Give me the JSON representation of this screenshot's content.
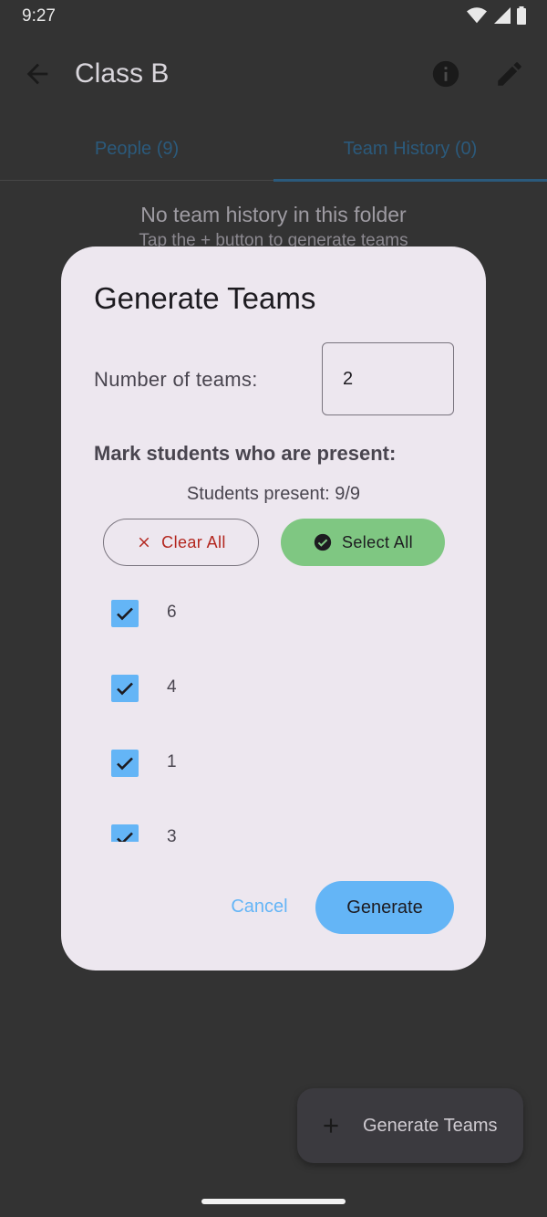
{
  "status_bar": {
    "time": "9:27"
  },
  "app_bar": {
    "title": "Class B"
  },
  "tabs": [
    {
      "label": "People (9)",
      "selected": false
    },
    {
      "label": "Team History (0)",
      "selected": true
    }
  ],
  "empty_state": {
    "title": "No team history in this folder",
    "subtitle": "Tap the + button to generate teams"
  },
  "fab": {
    "label": "Generate Teams"
  },
  "dialog": {
    "title": "Generate Teams",
    "number_label": "Number of teams:",
    "number_value": "2",
    "mark_label": "Mark students who are present:",
    "present_count": "Students present: 9/9",
    "clear_all_label": "Clear All",
    "select_all_label": "Select All",
    "students": [
      {
        "name": "6",
        "checked": true
      },
      {
        "name": "4",
        "checked": true
      },
      {
        "name": "1",
        "checked": true
      },
      {
        "name": "3",
        "checked": true
      }
    ],
    "cancel_label": "Cancel",
    "generate_label": "Generate"
  },
  "colors": {
    "accent": "#64b5f6",
    "select_all_bg": "#7fc782",
    "clear_all_text": "#b3261e",
    "dialog_bg": "#ede7ef",
    "scrim_bg": "#333333"
  }
}
